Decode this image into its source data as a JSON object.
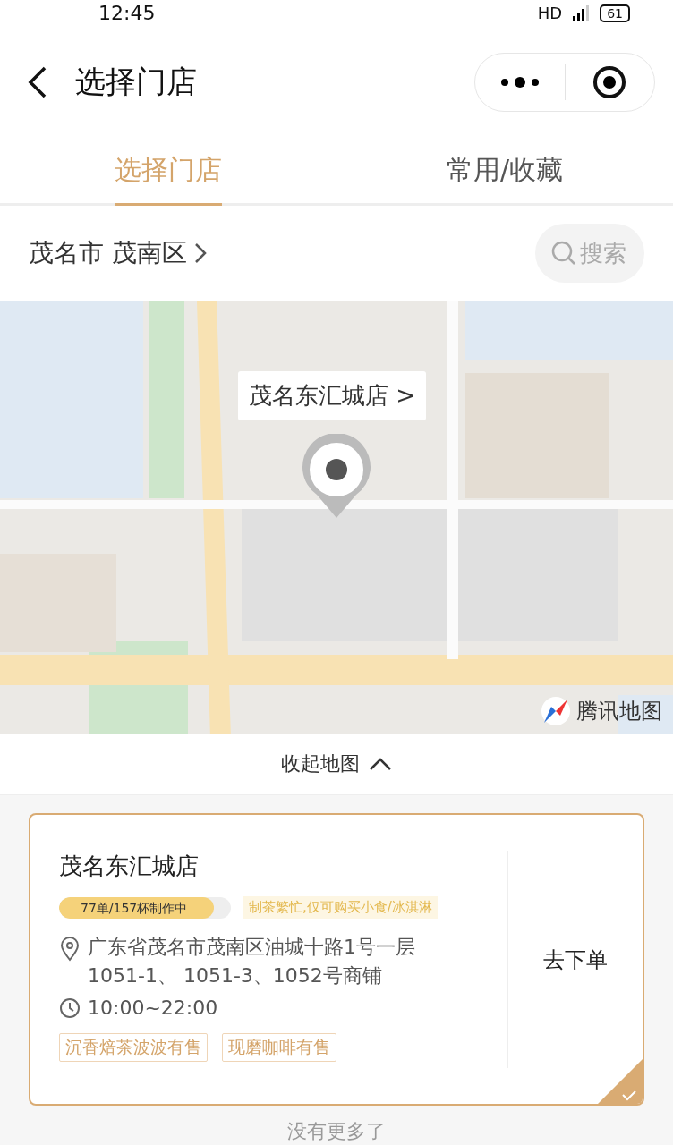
{
  "status_bar": {
    "time": "12:45",
    "network": "HD",
    "battery": "61"
  },
  "nav": {
    "title": "选择门店"
  },
  "tabs": [
    {
      "label": "选择门店",
      "selected": true
    },
    {
      "label": "常用/收藏",
      "selected": false
    }
  ],
  "location": {
    "city": "茂名市 茂南区",
    "search_placeholder": "搜索"
  },
  "map": {
    "kind": "picture",
    "callout": "茂名东汇城店 >",
    "attribution": "腾讯地图"
  },
  "collapse_map": "收起地图",
  "stores": [
    {
      "name": "茂名东汇城店",
      "progress": {
        "label": "77单/157杯制作中",
        "level": 0.9
      },
      "notice": "制茶繁忙,仅可购买小食/冰淇淋",
      "address": "广东省茂名市茂南区油城十路1号一层\n1051-1、 1051-3、1052号商铺",
      "hours": "10:00~22:00",
      "tags": [
        "沉香焙茶波波有售",
        "现磨咖啡有售"
      ],
      "action": "去下单",
      "selected": true
    }
  ],
  "footer": "没有更多了"
}
